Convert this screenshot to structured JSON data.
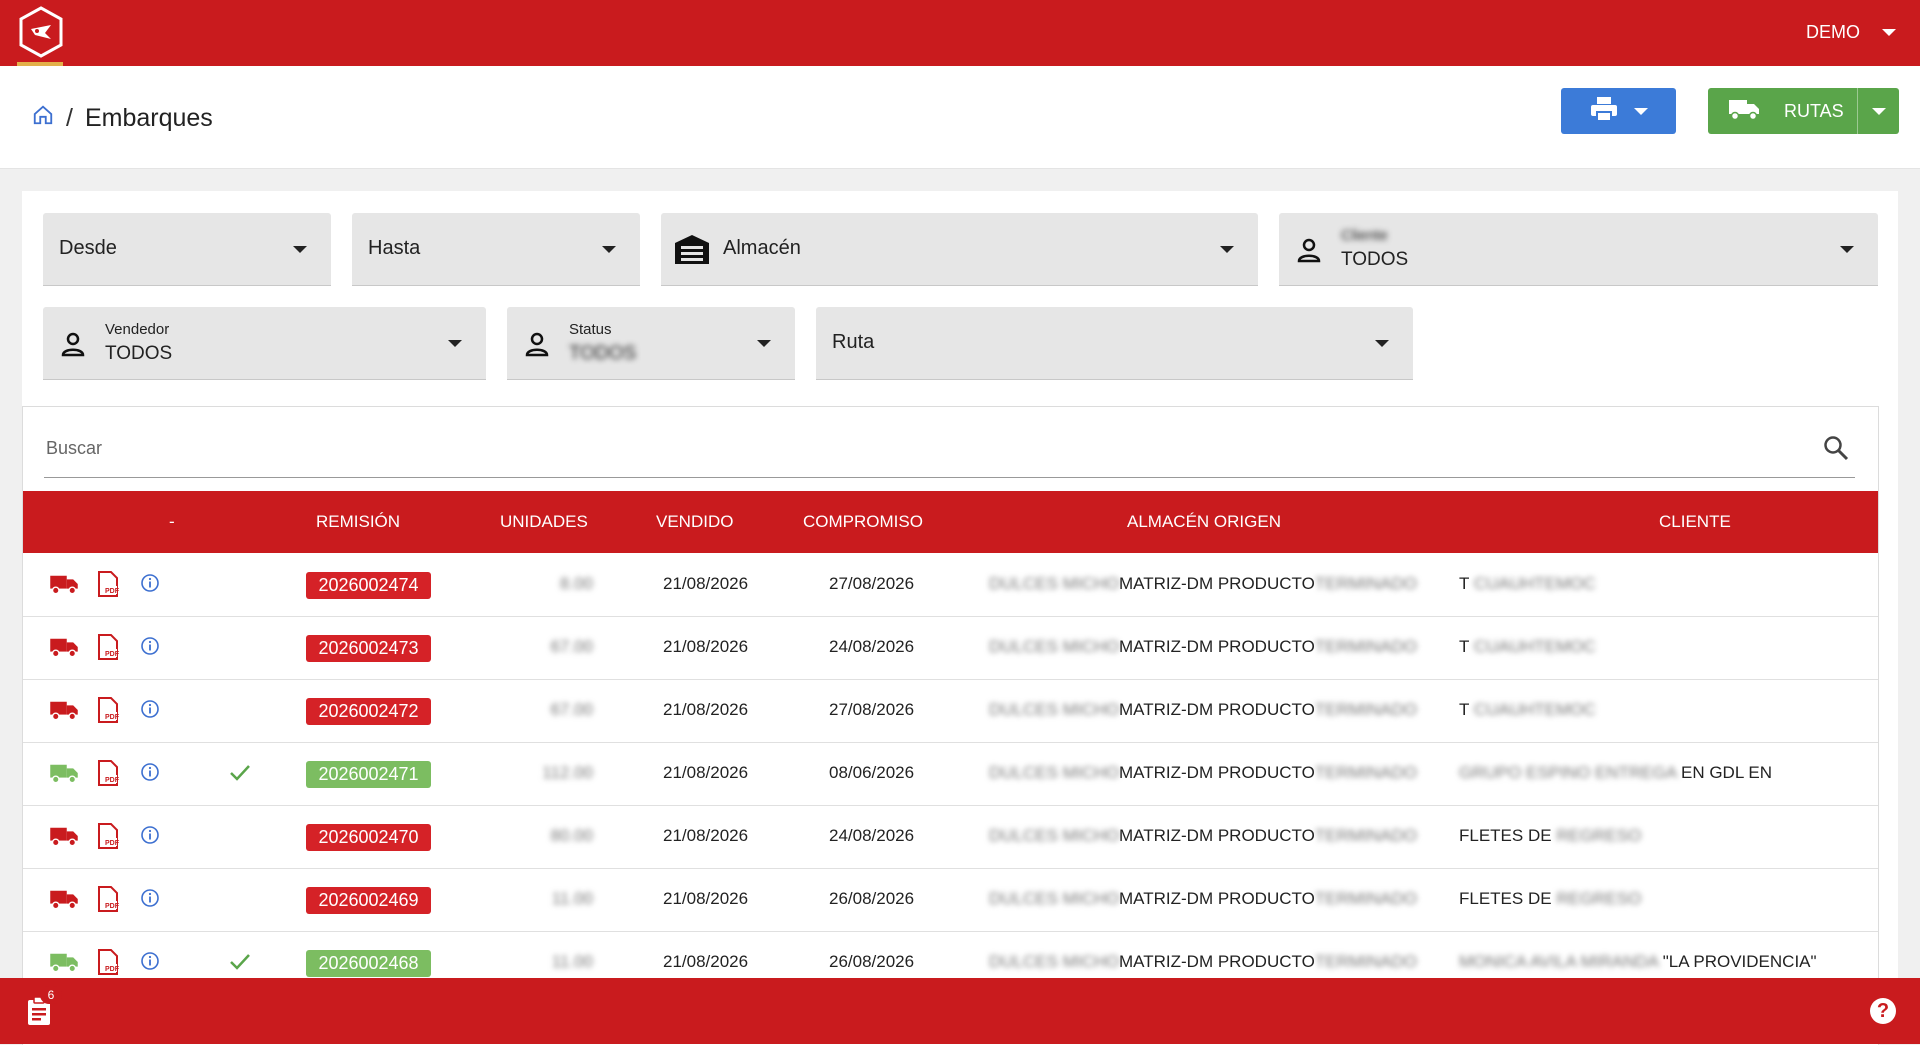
{
  "topbar": {
    "user": "DEMO"
  },
  "breadcrumb": {
    "separator": "/",
    "title": "Embarques"
  },
  "toolbar": {
    "rutas_label": "RUTAS"
  },
  "filters": {
    "desde": "Desde",
    "hasta": "Hasta",
    "almacen": "Almacén",
    "cliente_label": "Cliente",
    "cliente_value": "TODOS",
    "vendedor_label": "Vendedor",
    "vendedor_value": "TODOS",
    "status_label": "Status",
    "status_value": "TODOS",
    "ruta": "Ruta"
  },
  "search": {
    "placeholder": "Buscar"
  },
  "table": {
    "headers": [
      "-",
      "REMISIÓN",
      "UNIDADES",
      "VENDIDO",
      "COMPROMISO",
      "ALMACÉN ORIGEN",
      "CLIENTE"
    ],
    "rows": [
      {
        "status": "red",
        "checked": false,
        "remision": "2026002474",
        "unidades": "8.00",
        "vendido": "21/08/2026",
        "compromiso": "27/08/2026",
        "almacen_pre": "DULCES MICHO",
        "almacen": "MATRIZ-DM PRODUCTO",
        "almacen_post": "TERMINADO",
        "cliente": "T",
        "cliente_blur": "CUAUHTEMOC",
        "cliente_post": ""
      },
      {
        "status": "red",
        "checked": false,
        "remision": "2026002473",
        "unidades": "67.00",
        "vendido": "21/08/2026",
        "compromiso": "24/08/2026",
        "almacen_pre": "DULCES MICHO",
        "almacen": "MATRIZ-DM PRODUCTO",
        "almacen_post": "TERMINADO",
        "cliente": "T",
        "cliente_blur": "CUAUHTEMOC",
        "cliente_post": ""
      },
      {
        "status": "red",
        "checked": false,
        "remision": "2026002472",
        "unidades": "67.00",
        "vendido": "21/08/2026",
        "compromiso": "27/08/2026",
        "almacen_pre": "DULCES MICHO",
        "almacen": "MATRIZ-DM PRODUCTO",
        "almacen_post": "TERMINADO",
        "cliente": "T",
        "cliente_blur": "CUAUHTEMOC",
        "cliente_post": ""
      },
      {
        "status": "green",
        "checked": true,
        "remision": "2026002471",
        "unidades": "112.00",
        "vendido": "21/08/2026",
        "compromiso": "08/06/2026",
        "almacen_pre": "DULCES MICHO",
        "almacen": "MATRIZ-DM PRODUCTO",
        "almacen_post": "TERMINADO",
        "cliente": "",
        "cliente_blur": "GRUPO ESPINO ENTREGA",
        "cliente_post": "EN GDL EN"
      },
      {
        "status": "red",
        "checked": false,
        "remision": "2026002470",
        "unidades": "80.00",
        "vendido": "21/08/2026",
        "compromiso": "24/08/2026",
        "almacen_pre": "DULCES MICHO",
        "almacen": "MATRIZ-DM PRODUCTO",
        "almacen_post": "TERMINADO",
        "cliente": "FLETES DE",
        "cliente_blur": "REGRESO",
        "cliente_post": ""
      },
      {
        "status": "red",
        "checked": false,
        "remision": "2026002469",
        "unidades": "11.00",
        "vendido": "21/08/2026",
        "compromiso": "26/08/2026",
        "almacen_pre": "DULCES MICHO",
        "almacen": "MATRIZ-DM PRODUCTO",
        "almacen_post": "TERMINADO",
        "cliente": "FLETES DE",
        "cliente_blur": "REGRESO",
        "cliente_post": ""
      },
      {
        "status": "green",
        "checked": true,
        "remision": "2026002468",
        "unidades": "11.00",
        "vendido": "21/08/2026",
        "compromiso": "26/08/2026",
        "almacen_pre": "DULCES MICHO",
        "almacen": "MATRIZ-DM PRODUCTO",
        "almacen_post": "TERMINADO",
        "cliente": "",
        "cliente_blur": "MONICA AVILA MIRANDA",
        "cliente_post": "\"LA PROVIDENCIA\""
      }
    ]
  },
  "bottombar": {
    "notifications": "6",
    "help": "?"
  },
  "colors": {
    "brand_red": "#c91b1e",
    "primary_blue": "#3c7bd8",
    "success_green": "#5aa54a",
    "badge_red": "#d52227",
    "badge_green": "#7cbd61"
  }
}
